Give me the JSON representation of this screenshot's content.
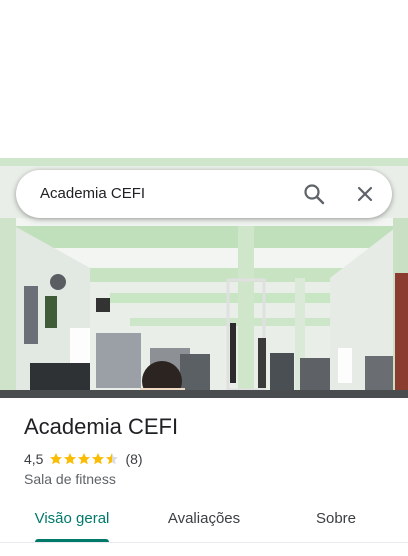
{
  "search": {
    "value": "Academia CEFI"
  },
  "place": {
    "name": "Academia CEFI",
    "rating": "4,5",
    "stars": 4.5,
    "reviews_count": "(8)",
    "category": "Sala de fitness"
  },
  "tabs": [
    {
      "label": "Visão geral",
      "active": true
    },
    {
      "label": "Avaliações",
      "active": false
    },
    {
      "label": "Sobre",
      "active": false
    }
  ],
  "colors": {
    "accent": "#00796b",
    "star": "#fbbc04",
    "wall_green": "#b8dcb4"
  },
  "icons": {
    "search": "search-icon",
    "close": "close-icon",
    "star": "star-icon"
  }
}
